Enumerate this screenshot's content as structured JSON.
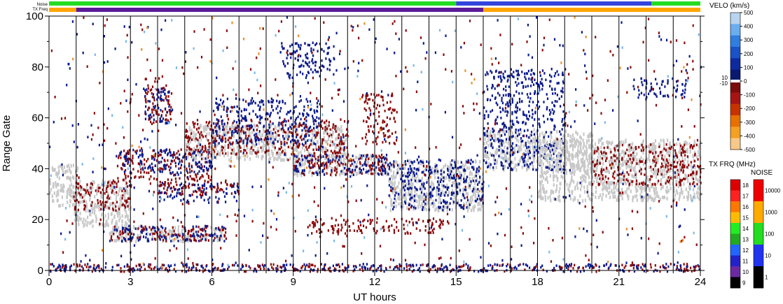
{
  "chart_data": {
    "type": "heatmap",
    "xlabel": "UT hours",
    "ylabel": "Range Gate",
    "xlim": [
      0,
      24
    ],
    "ylim": [
      0,
      100
    ],
    "x_ticks": [
      "0",
      "3",
      "6",
      "9",
      "12",
      "15",
      "18",
      "21",
      "24"
    ],
    "y_ticks": [
      "0",
      "20",
      "40",
      "60",
      "80",
      "100"
    ],
    "vertical_grid_hours": [
      1,
      2,
      3,
      4,
      5,
      6,
      7,
      8,
      9,
      10,
      11,
      12,
      13,
      14,
      15,
      16,
      17,
      18,
      19,
      20,
      21,
      22,
      23
    ],
    "status_bars": [
      {
        "label": "Noise",
        "segments": [
          {
            "from": 0,
            "to": 15.0,
            "color": "#22dd22"
          },
          {
            "from": 15.0,
            "to": 22.2,
            "color": "#3344dd"
          },
          {
            "from": 22.2,
            "to": 24,
            "color": "#22dd22"
          }
        ]
      },
      {
        "label": "TX Freq",
        "segments": [
          {
            "from": 0,
            "to": 1.0,
            "color": "#ffa500"
          },
          {
            "from": 1.0,
            "to": 16.0,
            "color": "#5a1a9a"
          },
          {
            "from": 16.0,
            "to": 24,
            "color": "#ffa500"
          }
        ]
      }
    ],
    "scatter_regions": [
      {
        "hours": [
          0,
          1.1
        ],
        "gates": [
          26,
          42
        ],
        "class": "ground"
      },
      {
        "hours": [
          0.9,
          3.0
        ],
        "gates": [
          18,
          36
        ],
        "class": "ground"
      },
      {
        "hours": [
          0.9,
          3.0
        ],
        "gates": [
          24,
          36
        ],
        "class": "negative"
      },
      {
        "hours": [
          2.2,
          6.5
        ],
        "gates": [
          12,
          18
        ],
        "class": "ground"
      },
      {
        "hours": [
          2.2,
          6.5
        ],
        "gates": [
          12,
          18
        ],
        "class": "negative"
      },
      {
        "hours": [
          2.2,
          6.5
        ],
        "gates": [
          12,
          18
        ],
        "class": "positive"
      },
      {
        "hours": [
          4.0,
          7.0
        ],
        "gates": [
          27,
          35
        ],
        "class": "positive"
      },
      {
        "hours": [
          4.0,
          7.0
        ],
        "gates": [
          30,
          36
        ],
        "class": "negative"
      },
      {
        "hours": [
          2.5,
          6.0
        ],
        "gates": [
          36,
          48
        ],
        "class": "negative"
      },
      {
        "hours": [
          2.5,
          6.0
        ],
        "gates": [
          38,
          48
        ],
        "class": "positive"
      },
      {
        "hours": [
          5.0,
          11.0
        ],
        "gates": [
          44,
          58
        ],
        "class": "ground"
      },
      {
        "hours": [
          5.0,
          11.0
        ],
        "gates": [
          46,
          60
        ],
        "class": "negative"
      },
      {
        "hours": [
          6.0,
          10.0
        ],
        "gates": [
          50,
          68
        ],
        "class": "positive"
      },
      {
        "hours": [
          3.5,
          4.5
        ],
        "gates": [
          58,
          76
        ],
        "class": "negative"
      },
      {
        "hours": [
          3.5,
          4.5
        ],
        "gates": [
          58,
          72
        ],
        "class": "positive"
      },
      {
        "hours": [
          9.0,
          12.5
        ],
        "gates": [
          38,
          46
        ],
        "class": "ground"
      },
      {
        "hours": [
          9.0,
          12.5
        ],
        "gates": [
          38,
          46
        ],
        "class": "negative"
      },
      {
        "hours": [
          9.0,
          12.5
        ],
        "gates": [
          38,
          46
        ],
        "class": "positive"
      },
      {
        "hours": [
          11.5,
          12.8
        ],
        "gates": [
          50,
          70
        ],
        "class": "negative"
      },
      {
        "hours": [
          12.5,
          16.0
        ],
        "gates": [
          24,
          44
        ],
        "class": "ground"
      },
      {
        "hours": [
          12.5,
          16.0
        ],
        "gates": [
          24,
          44
        ],
        "class": "positive"
      },
      {
        "hours": [
          9.5,
          14.5
        ],
        "gates": [
          15,
          21
        ],
        "class": "negative"
      },
      {
        "hours": [
          8.5,
          10.5
        ],
        "gates": [
          76,
          90
        ],
        "class": "positive"
      },
      {
        "hours": [
          0,
          24
        ],
        "gates": [
          0,
          3
        ],
        "class": "negative"
      },
      {
        "hours": [
          0,
          24
        ],
        "gates": [
          0,
          3
        ],
        "class": "positive"
      },
      {
        "hours": [
          16.0,
          20.0
        ],
        "gates": [
          40,
          56
        ],
        "class": "ground"
      },
      {
        "hours": [
          16.0,
          19.0
        ],
        "gates": [
          40,
          80
        ],
        "class": "positive"
      },
      {
        "hours": [
          18.0,
          24.0
        ],
        "gates": [
          28,
          52
        ],
        "class": "ground"
      },
      {
        "hours": [
          20.0,
          24.0
        ],
        "gates": [
          34,
          50
        ],
        "class": "negative"
      },
      {
        "hours": [
          21.5,
          23.5
        ],
        "gates": [
          68,
          76
        ],
        "class": "positive"
      },
      {
        "hours": [
          0,
          24
        ],
        "gates": [
          0,
          100
        ],
        "class": "noise"
      }
    ]
  },
  "header": {
    "noise_label": "Noise",
    "txfreq_label": "TX Freq"
  },
  "velo_colorbar": {
    "title": "VELO (km/s)",
    "ticks": [
      "500",
      "400",
      "300",
      "200",
      "100",
      "0",
      "-100",
      "-200",
      "-300",
      "-400",
      "-500"
    ],
    "threshold_labels": [
      "10",
      "-10"
    ],
    "colors": [
      "#b8d4f0",
      "#6aaef0",
      "#2f7ee0",
      "#1a52c8",
      "#0d2aa0",
      "#081a70",
      "#7a0c0c",
      "#a81414",
      "#c83200",
      "#e87000",
      "#f5a020",
      "#f8c888"
    ]
  },
  "txfreq_colorbar": {
    "title": "TX FRQ (MHz)",
    "ticks": [
      "18",
      "17",
      "16",
      "15",
      "14",
      "13",
      "12",
      "11",
      "10",
      "9"
    ],
    "colors": [
      "#dd0000",
      "#ff2222",
      "#ff7700",
      "#ffbb00",
      "#22ee22",
      "#22aa22",
      "#2266ff",
      "#2222cc",
      "#6a2aa0",
      "#000000"
    ]
  },
  "noise_colorbar": {
    "title": "NOISE",
    "ticks": [
      "10000",
      "1000",
      "100",
      "10",
      "1"
    ],
    "colors": [
      "#ee0000",
      "#ffaa00",
      "#22dd22",
      "#2233ee",
      "#000000"
    ]
  },
  "colors": {
    "ground": "#c8c8c8",
    "negative": "#8b0a0a",
    "positive": "#0a1a8c",
    "noise_light_blue": "#7ab8e8",
    "noise_orange": "#e89030"
  }
}
